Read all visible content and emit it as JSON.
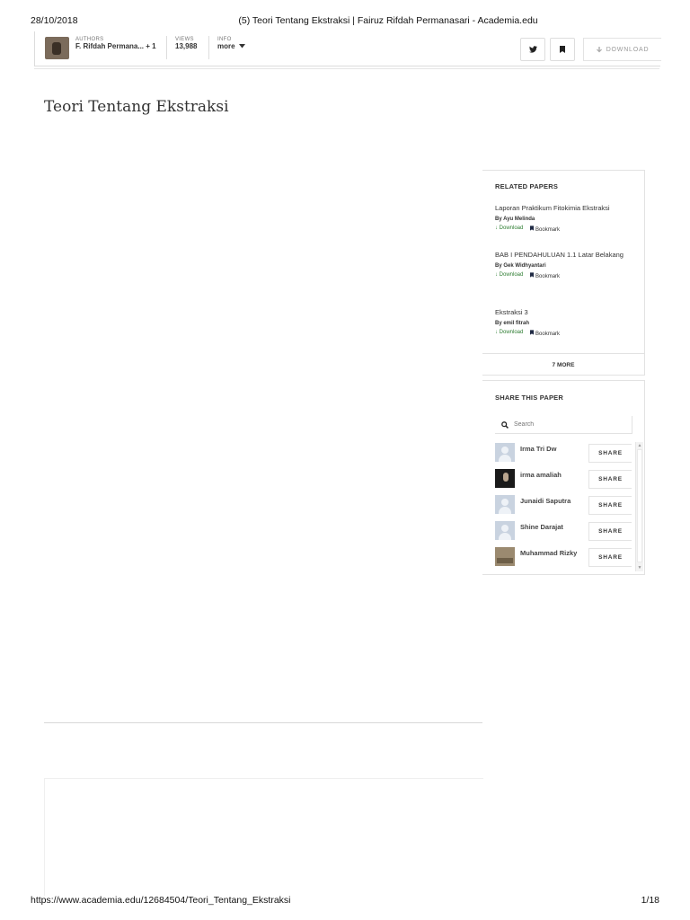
{
  "print": {
    "date": "28/10/2018",
    "title": "(5) Teori Tentang Ekstraksi | Fairuz Rifdah Permanasari - Academia.edu",
    "url": "https://www.academia.edu/12684504/Teori_Tentang_Ekstraksi",
    "page": "1/18"
  },
  "topbar": {
    "authors_label": "AUTHORS",
    "authors_value": "F. Rifdah Permana... + 1",
    "views_label": "VIEWS",
    "views_value": "13,988",
    "info_label": "INFO",
    "info_value": "more",
    "download_label": "DOWNLOAD",
    "icons": [
      "twitter-icon",
      "bookmark-icon",
      "download-arrow-icon"
    ]
  },
  "document": {
    "title": "Teori Tentang Ekstraksi"
  },
  "related": {
    "heading": "RELATED PAPERS",
    "papers": [
      {
        "title": "Laporan Praktikum Fitokimia Ekstraksi",
        "by": "By Ayu Melinda",
        "download": "Download",
        "bookmark": "Bookmark"
      },
      {
        "title": "BAB I PENDAHULUAN 1.1 Latar Belakang",
        "by": "By Gek Widhyantari",
        "download": "Download",
        "bookmark": "Bookmark"
      },
      {
        "title": "Ekstraksi 3",
        "by": "By emil fitrah",
        "download": "Download",
        "bookmark": "Bookmark"
      }
    ],
    "more": "7 MORE"
  },
  "share": {
    "heading": "SHARE THIS PAPER",
    "search_placeholder": "Search",
    "button_label": "SHARE",
    "users": [
      {
        "name": "Irma Tri Dw"
      },
      {
        "name": "irma amaliah"
      },
      {
        "name": "Junaidi Saputra"
      },
      {
        "name": "Shine Darajat"
      },
      {
        "name": "Muhammad Rizky"
      }
    ]
  },
  "colors": {
    "download_green": "#2e7d32",
    "bookmark_navy": "#1f2a44",
    "avatar_placeholder": "#c9d3e0"
  }
}
